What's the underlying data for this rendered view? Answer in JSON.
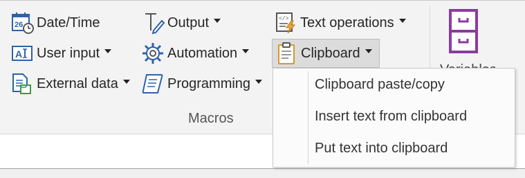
{
  "ribbon": {
    "group_label": "Macros",
    "buttons": {
      "datetime": "Date/Time",
      "user_input": "User input",
      "external_data": "External data",
      "output": "Output",
      "automation": "Automation",
      "programming": "Programming",
      "text_operations": "Text operations",
      "clipboard": "Clipboard"
    },
    "variables_label": "Variables"
  },
  "clipboard_menu": {
    "items": [
      "Clipboard paste/copy",
      "Insert text from clipboard",
      "Put text into clipboard"
    ]
  },
  "colors": {
    "accent_blue": "#2b63a8",
    "variables_purple": "#8b3aa0",
    "clipboard_orange": "#d9952b"
  }
}
